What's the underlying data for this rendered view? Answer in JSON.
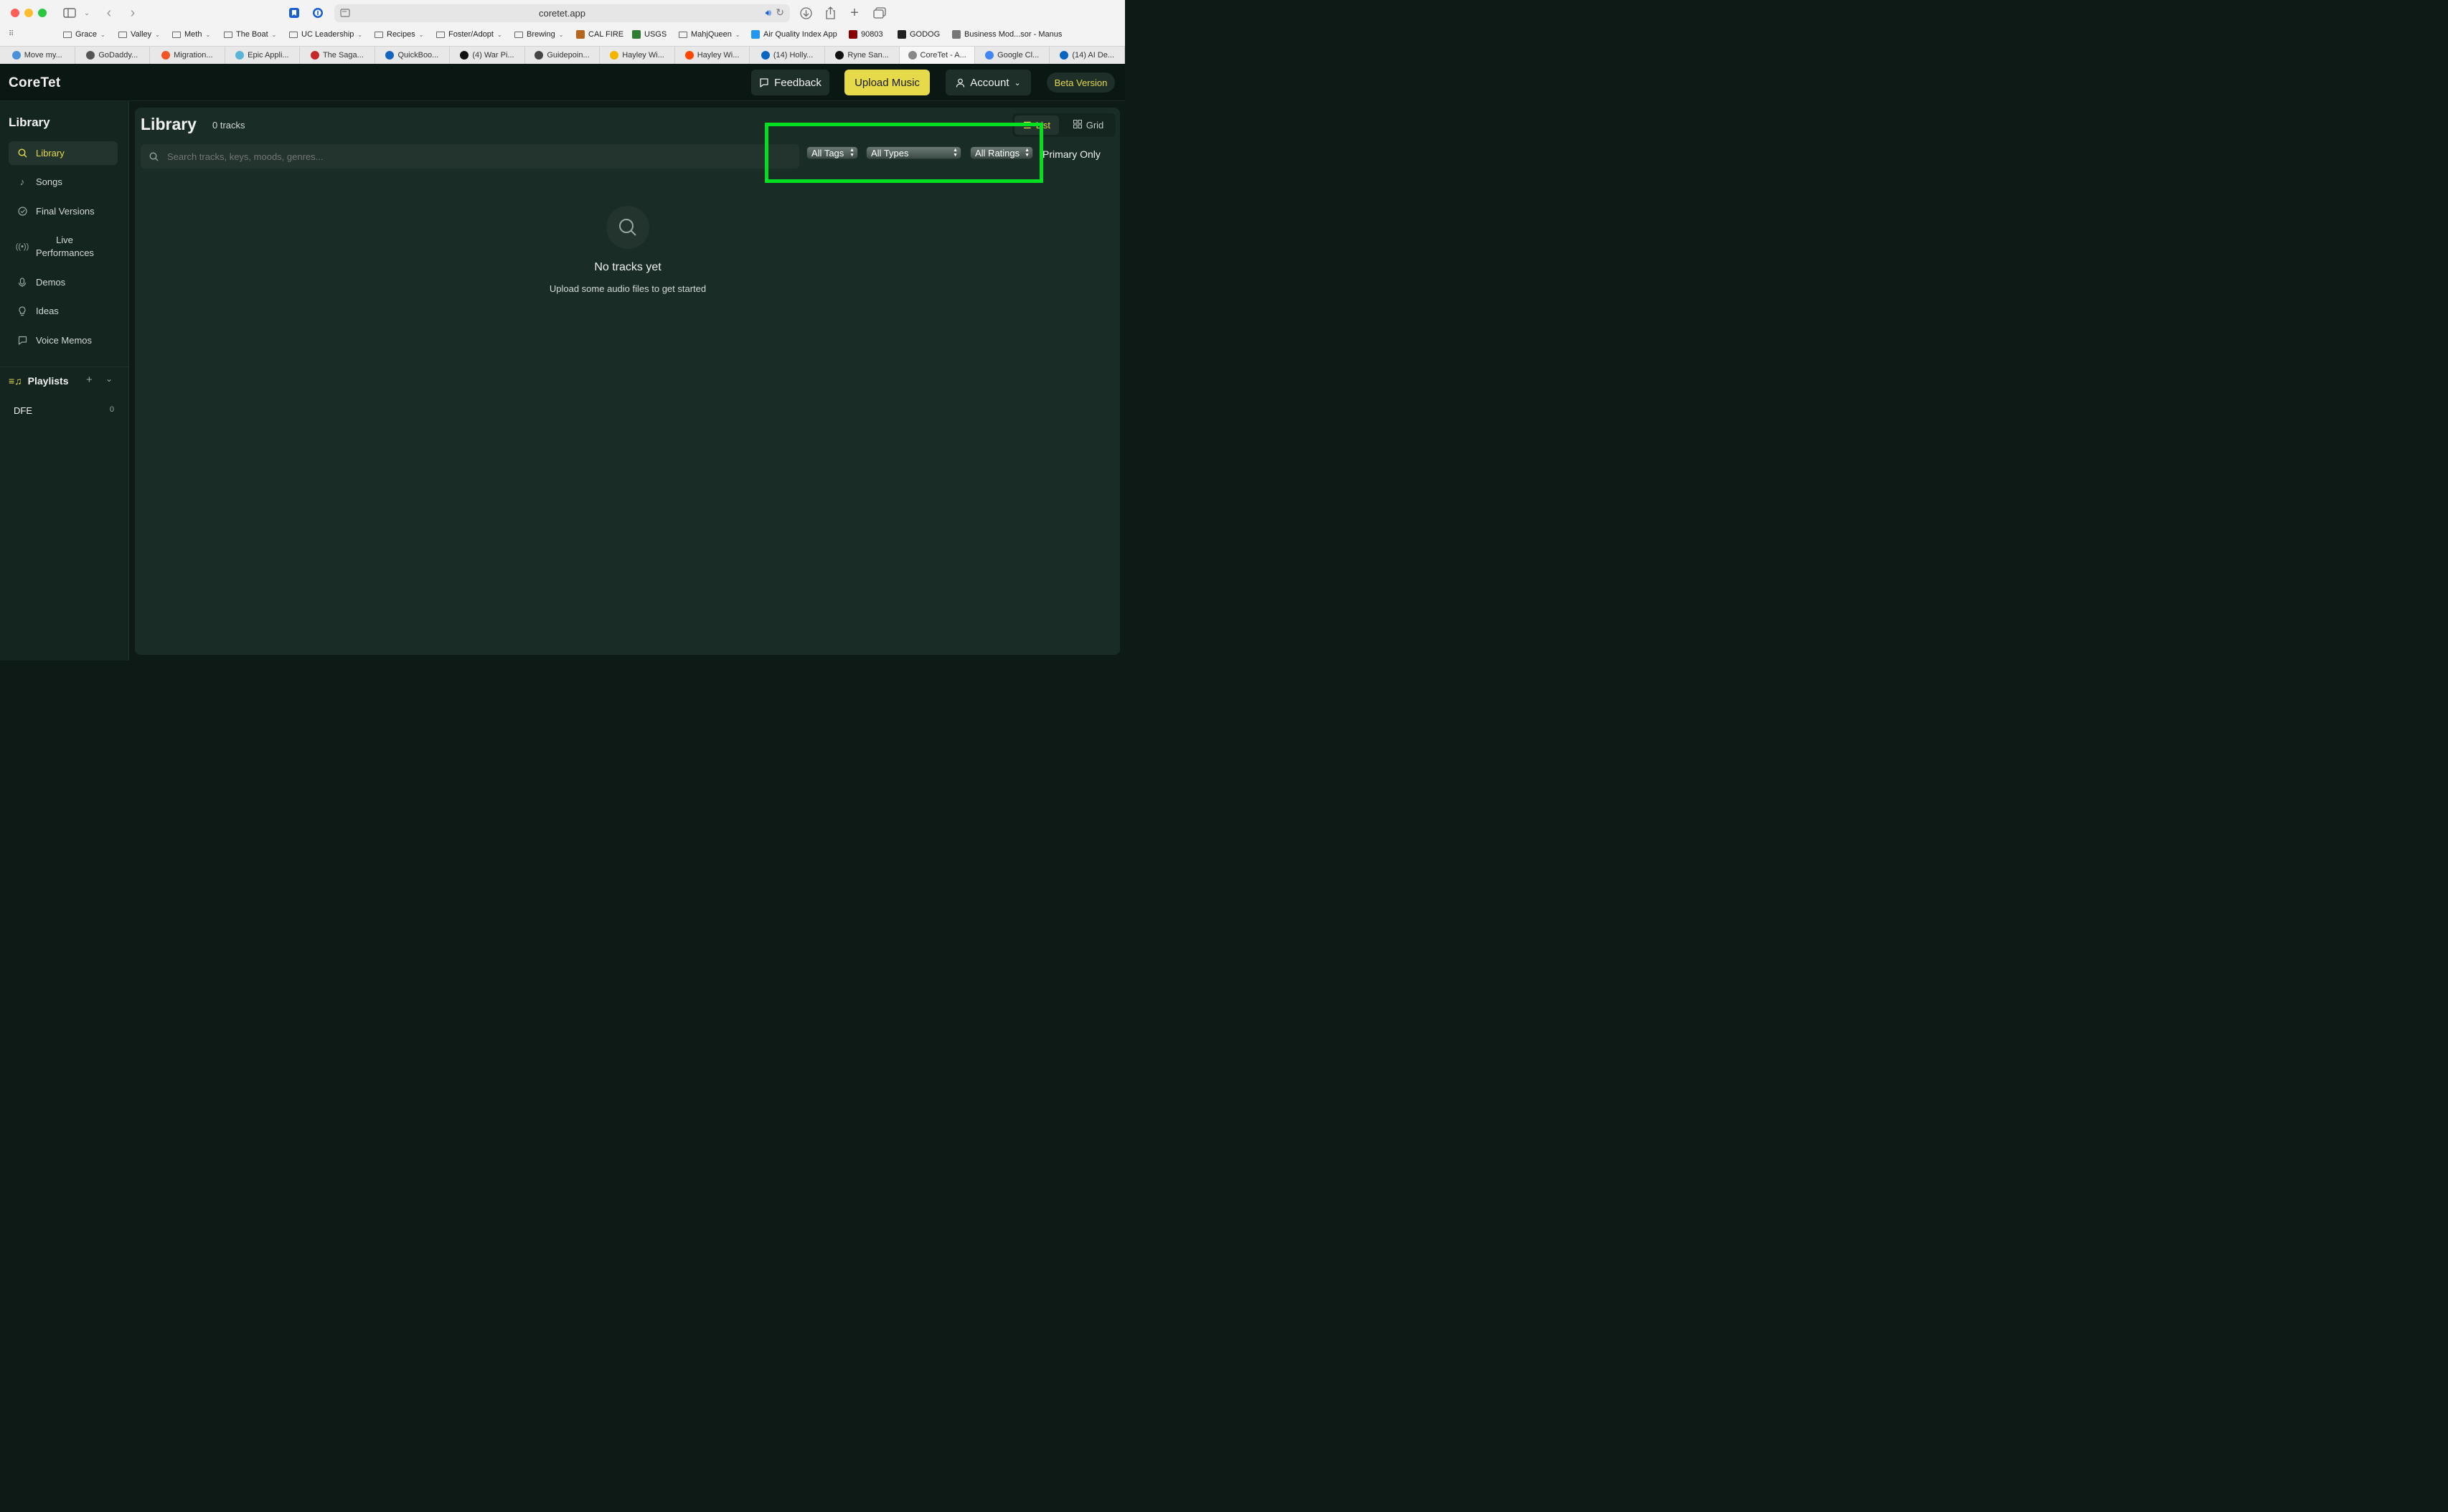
{
  "browser": {
    "url": "coretet.app",
    "bookmarks": [
      {
        "label": "Grace",
        "folder": true
      },
      {
        "label": "Valley",
        "folder": true
      },
      {
        "label": "Meth",
        "folder": true
      },
      {
        "label": "The Boat",
        "folder": true
      },
      {
        "label": "UC Leadership",
        "folder": true
      },
      {
        "label": "Recipes",
        "folder": true
      },
      {
        "label": "Foster/Adopt",
        "folder": true
      },
      {
        "label": "Brewing",
        "folder": true
      },
      {
        "label": "CAL FIRE",
        "folder": false,
        "color": "#b5651d"
      },
      {
        "label": "USGS",
        "folder": false,
        "color": "#2e7d32"
      },
      {
        "label": "MahjQueen",
        "folder": true
      },
      {
        "label": "Air Quality Index App",
        "folder": false,
        "color": "#2196f3"
      },
      {
        "label": "90803",
        "folder": false,
        "color": "#8b0000"
      },
      {
        "label": "GODOG",
        "folder": false,
        "color": "#222222"
      },
      {
        "label": "Business Mod...sor - Manus",
        "folder": false,
        "color": "#777777"
      }
    ],
    "tabs": [
      {
        "label": "Move my...",
        "color": "#4a90d9"
      },
      {
        "label": "GoDaddy...",
        "color": "#555555"
      },
      {
        "label": "Migration...",
        "color": "#f35325"
      },
      {
        "label": "Epic Appli...",
        "color": "#5ab4d6"
      },
      {
        "label": "The Saga...",
        "color": "#c62828"
      },
      {
        "label": "QuickBoo...",
        "color": "#1565c0"
      },
      {
        "label": "(4) War Pi...",
        "color": "#111111"
      },
      {
        "label": "Guidepoin...",
        "color": "#444444"
      },
      {
        "label": "Hayley Wi...",
        "color": "#f5b400"
      },
      {
        "label": "Hayley Wi...",
        "color": "#ff4500"
      },
      {
        "label": "(14) Holly...",
        "color": "#0a66c2"
      },
      {
        "label": "Ryne San...",
        "color": "#111111"
      },
      {
        "label": "CoreTet - A...",
        "color": "#888888",
        "active": true
      },
      {
        "label": "Google Cl...",
        "color": "#4285f4"
      },
      {
        "label": "(14) AI De...",
        "color": "#0a66c2"
      }
    ]
  },
  "header": {
    "logo": "CoreTet",
    "feedback": "Feedback",
    "upload": "Upload Music",
    "account": "Account",
    "beta": "Beta Version"
  },
  "sidebar": {
    "title": "Library",
    "items": [
      {
        "label": "Library",
        "icon": "search-icon",
        "active": true
      },
      {
        "label": "Songs",
        "icon": "music-note-icon"
      },
      {
        "label": "Final Versions",
        "icon": "check-circle-icon"
      },
      {
        "label": "Live Performances",
        "icon": "broadcast-icon"
      },
      {
        "label": "Demos",
        "icon": "microphone-icon"
      },
      {
        "label": "Ideas",
        "icon": "lightbulb-icon"
      },
      {
        "label": "Voice Memos",
        "icon": "message-icon"
      }
    ],
    "playlists_title": "Playlists",
    "playlists": [
      {
        "label": "DFE",
        "count": "0"
      }
    ]
  },
  "main": {
    "title": "Library",
    "count": "0 tracks",
    "view_list": "List",
    "view_grid": "Grid",
    "search_placeholder": "Search tracks, keys, moods, genres...",
    "filters": {
      "tags": "All Tags",
      "types": "All Types",
      "ratings": "All Ratings"
    },
    "primary_only": "Primary Only",
    "empty_title": "No tracks yet",
    "empty_sub": "Upload some audio files to get started"
  },
  "colors": {
    "accent": "#e6d94a",
    "highlight": "#00e020"
  }
}
